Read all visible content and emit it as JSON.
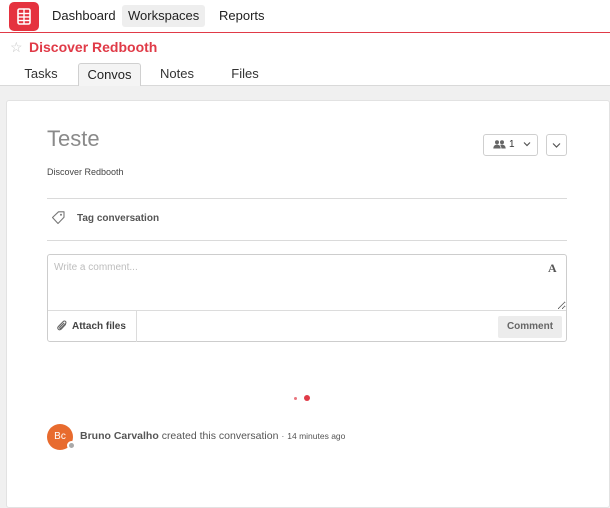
{
  "topnav": {
    "logo_icon": "redbooth-logo-icon",
    "items": [
      {
        "label": "Dashboard",
        "active": false
      },
      {
        "label": "Workspaces",
        "active": true
      },
      {
        "label": "Reports",
        "active": false
      }
    ]
  },
  "workspace": {
    "star_icon": "star-icon",
    "title": "Discover Redbooth",
    "tabs": [
      {
        "label": "Tasks",
        "active": false
      },
      {
        "label": "Convos",
        "active": true
      },
      {
        "label": "Notes",
        "active": false
      },
      {
        "label": "Files",
        "active": false
      }
    ]
  },
  "conversation": {
    "title": "Teste",
    "workspace_name": "Discover Redbooth",
    "participants_count": "1",
    "tag_label": "Tag conversation",
    "comment_placeholder": "Write a comment...",
    "format_icon_glyph": "A",
    "attach_label": "Attach files",
    "comment_button": "Comment"
  },
  "activity": {
    "avatar_initials": "Bc",
    "user": "Bruno Carvalho",
    "action": "created this conversation",
    "separator": "·",
    "time": "14 minutes ago"
  },
  "colors": {
    "brand": "#e03a47",
    "avatar": "#e86b2e"
  }
}
